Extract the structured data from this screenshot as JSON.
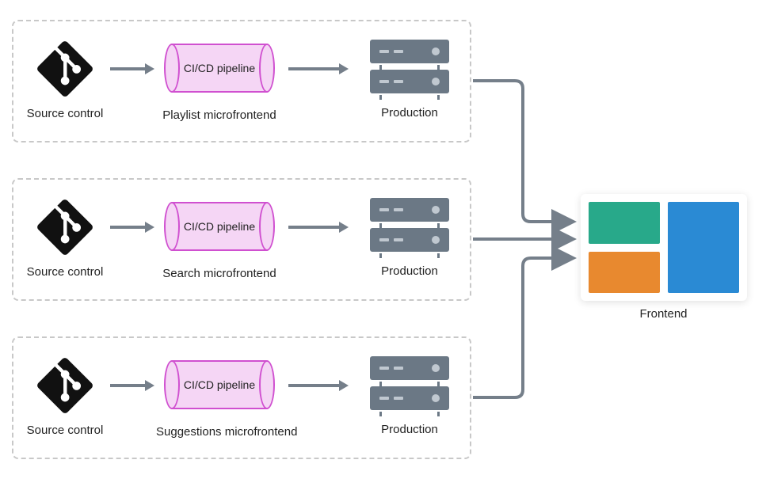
{
  "pipelines": [
    {
      "source_label": "Source control",
      "pipeline_text": "CI/CD pipeline",
      "pipeline_label": "Playlist microfrontend",
      "prod_label": "Production"
    },
    {
      "source_label": "Source control",
      "pipeline_text": "CI/CD pipeline",
      "pipeline_label": "Search microfrontend",
      "prod_label": "Production"
    },
    {
      "source_label": "Source control",
      "pipeline_text": "CI/CD pipeline",
      "pipeline_label": "Suggestions microfrontend",
      "prod_label": "Production"
    }
  ],
  "frontend": {
    "label": "Frontend"
  }
}
